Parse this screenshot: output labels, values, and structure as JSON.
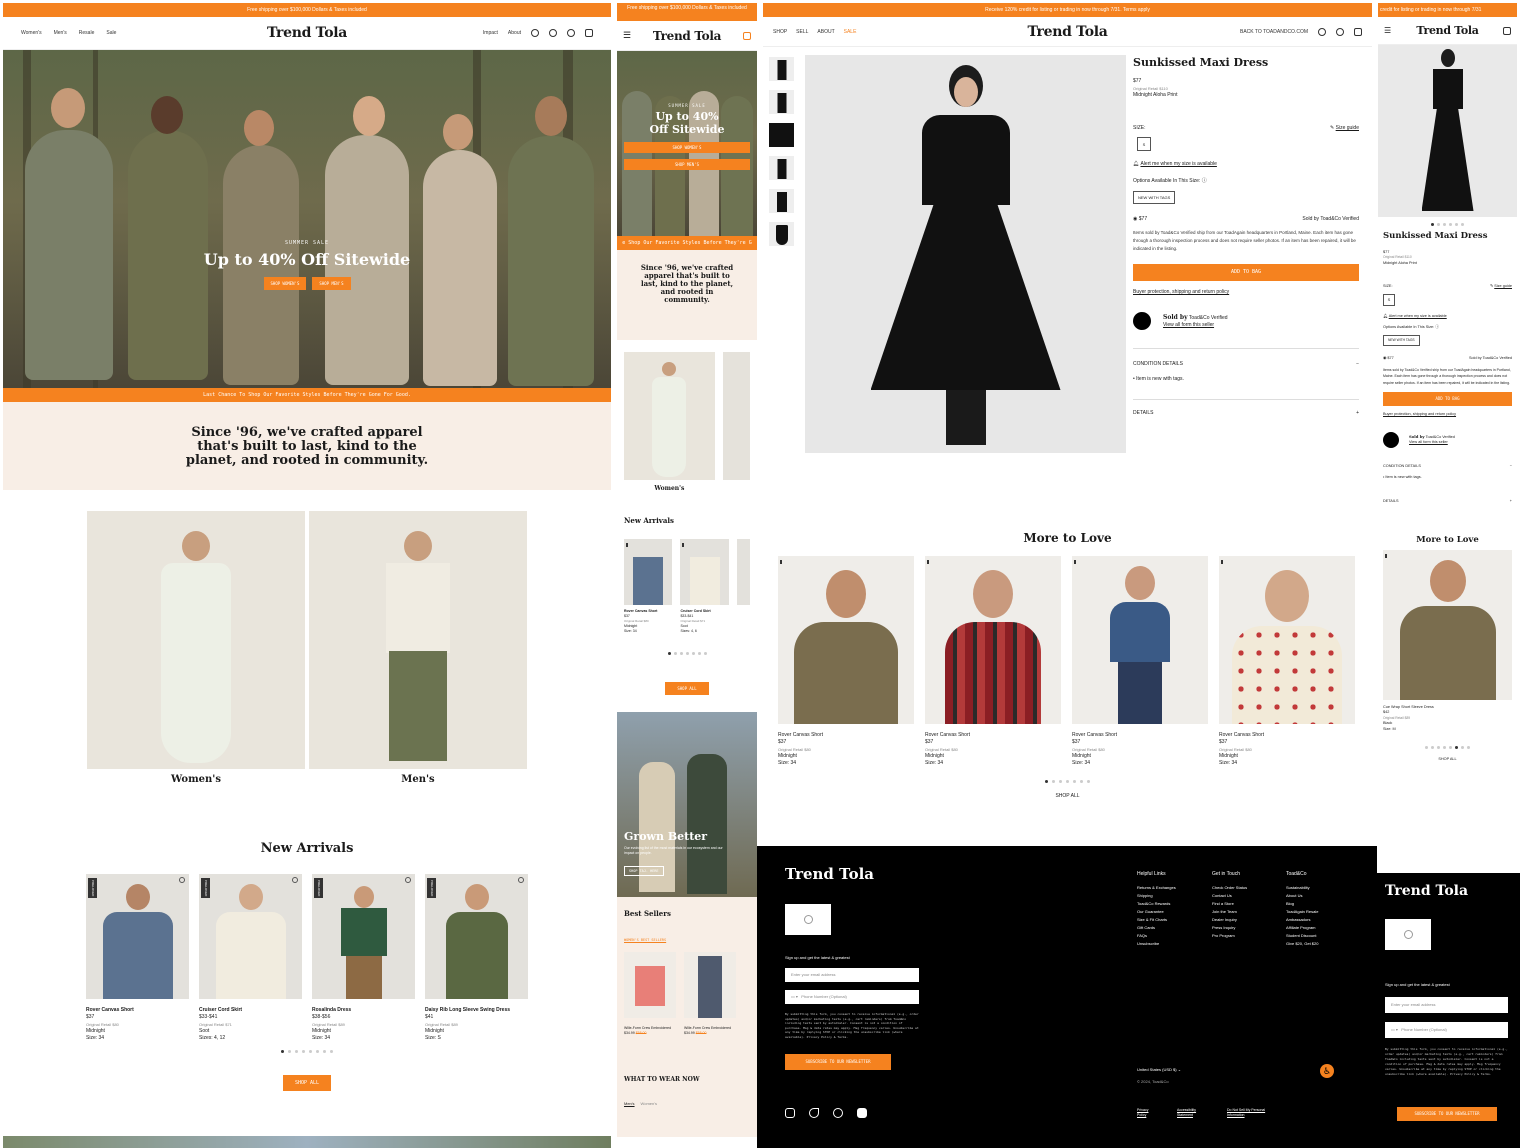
{
  "brand": "Trend Tola",
  "colors": {
    "accent": "#f5821f",
    "cream": "#f8eee6",
    "footer": "#000000"
  },
  "desktop_home": {
    "promo": "Free shipping over $100,000 Dollars & Taxes included",
    "nav_left": [
      "Women's",
      "Men's",
      "Resale",
      "Sale"
    ],
    "nav_right": [
      "Impact",
      "About"
    ],
    "hero_kicker": "SUMMER SALE",
    "hero_title": "Up to 40% Off Sitewide",
    "hero_btn_women": "SHOP WOMEN'S",
    "hero_btn_men": "SHOP MEN'S",
    "ticker": "Last Chance To Shop Our Favorite Styles Before They're Gone For Good.",
    "mission": "Since '96, we've crafted apparel that's built to last, kind to the planet, and rooted in community.",
    "categories": [
      "Women's",
      "Men's"
    ],
    "new_arrivals_title": "New Arrivals",
    "tag": "PRELOVED",
    "products": [
      {
        "name": "Rover Canvas Short",
        "price": "$37",
        "retail": "Original Retail $80",
        "color": "Midnight",
        "size": "Size: 34"
      },
      {
        "name": "Cruiser Cord Skirt",
        "price": "$33-$41",
        "retail": "Original Retail $71",
        "color": "Soot",
        "size": "Sizes: 4, 12"
      },
      {
        "name": "Rosalinda Dress",
        "price": "$38-$56",
        "retail": "Original Retail $89",
        "color": "Midnight",
        "size": "Size: 34"
      },
      {
        "name": "Daisy Rib Long Sleeve Swing Dress",
        "price": "$41",
        "retail": "Original Retail $89",
        "color": "Midnight",
        "size": "Size: S"
      }
    ],
    "shop_all": "SHOP ALL"
  },
  "mobile_home": {
    "promo": "Free shipping over $100,000 Dollars & Taxes included",
    "hero_kicker": "SUMMER SALE",
    "hero_title": "Up to 40% Off Sitewide",
    "hero_btn_women": "SHOP WOMEN'S",
    "hero_btn_men": "SHOP MEN'S",
    "ticker": "e Shop Our Favorite Styles Before They're G",
    "mission": "Since '96, we've crafted apparel that's built to last, kind to the planet, and rooted in community.",
    "cat_label": "Women's",
    "new_arrivals_title": "New Arrivals",
    "products": [
      {
        "name": "Rover Canvas Short",
        "price": "$37",
        "retail": "Original Retail $80",
        "color": "Midnight",
        "size": "Size: 34"
      },
      {
        "name": "Cruiser Cord Skirt",
        "price": "$33-$41",
        "retail": "Original Retail $71",
        "color": "Soot",
        "size": "Sizes: 4, 6"
      }
    ],
    "shop_all": "SHOP ALL",
    "grown_title": "Grown Better",
    "grown_text": "Our evolving list of the most materials in our ecosystem and our impact on people.",
    "grown_btn": "SHOP TAJ. HERE",
    "best_sellers": "Best Sellers",
    "best_tab": "WOMEN'S BEST SELLERS",
    "best_products": [
      {
        "name": "Wille-Form Crew Embroidered",
        "sale": "$34.99",
        "orig": "$58.00"
      },
      {
        "name": "Wille-Form Crew Embroidered",
        "sale": "$34.99",
        "orig": "$58.00"
      }
    ],
    "wear_title": "WHAT TO WEAR NOW",
    "wear_tabs": [
      "Men's",
      "Women's"
    ]
  },
  "desktop_pdp": {
    "promo": "Receive 120% credit for listing or trading in now through 7/31. Terms apply",
    "nav_left": [
      "SHOP",
      "SELL",
      "ABOUT",
      "SALE"
    ],
    "back_link": "BACK TO TOADANDCO.COM",
    "title": "Sunkissed Maxi Dress",
    "price": "$77",
    "retail": "Original Retail $110",
    "color": "Midnight Aloha Print",
    "size_label": "SIZE:",
    "size_guide": "Size guide",
    "size_value": "S",
    "alert_link": "Alert me when my size is available",
    "options_label": "Options Available In This Size:",
    "option_pill": "NEW WITH TAGS",
    "radio_price": "$77",
    "sold_by": "Sold by Toad&Co Verified",
    "desc": "Items sold by Toad&Co Verified ship from our ToadAgain headquarters in Portland, Maine. Each item has gone through a thorough inspection process and does not require seller photos. If an item has been repaired, it will be indicated in the listing.",
    "add_to_bag": "ADD TO BAG",
    "policy_link": "Buyer protection, shipping and return policy",
    "seller_title": "Sold by",
    "seller_name": "Toad&Co Verified",
    "seller_link": "View all form this seller",
    "condition_label": "CONDITION DETAILS",
    "condition_item": "Item is new with tags.",
    "details_label": "DETAILS",
    "more_title": "More to Love",
    "more_products": [
      {
        "name": "Rover Canvas Short",
        "price": "$37",
        "retail": "Original Retail $80",
        "color": "Midnight",
        "size": "Size: 34"
      },
      {
        "name": "Rover Canvas Short",
        "price": "$37",
        "retail": "Original Retail $80",
        "color": "Midnight",
        "size": "Size: 34"
      },
      {
        "name": "Rover Canvas Short",
        "price": "$37",
        "retail": "Original Retail $80",
        "color": "Midnight",
        "size": "Size: 34"
      },
      {
        "name": "Rover Canvas Short",
        "price": "$37",
        "retail": "Original Retail $80",
        "color": "Midnight",
        "size": "Size: 34"
      }
    ],
    "shop_all": "SHOP ALL"
  },
  "mobile_pdp": {
    "promo": "credit for listing or trading in now through 7/31",
    "title": "Sunkissed Maxi Dress",
    "price": "$77",
    "retail": "Original Retail $110",
    "color": "Midnight Aloha Print",
    "size_label": "SIZE:",
    "size_guide": "Size guide",
    "size_value": "S",
    "alert_link": "Alert me when my size is available",
    "options_label": "Options Available In This Size:",
    "option_pill": "NEW WITH TAGS",
    "radio_price": "$77",
    "sold_by": "Sold by Toad&Co Verified",
    "desc": "Items sold by Toad&Co Verified ship from our ToadAgain headquarters in Portland, Maine. Each item has gone through a thorough inspection process and does not require seller photos. If an item has been repaired, it will be indicated in the listing.",
    "add_to_bag": "ADD TO BAG",
    "policy_link": "Buyer protection, shipping and return policy",
    "seller_title": "Sold by",
    "seller_name": "Toad&Co Verified",
    "seller_link": "View all form this seller",
    "condition_label": "CONDITION DETAILS",
    "condition_item": "Item is new with tags.",
    "details_label": "DETAILS",
    "more_title": "More to Love",
    "more_product": {
      "name": "Cue Wrap Short Sleeve Dress",
      "price": "$42",
      "retail": "Original Retail $89",
      "color": "Black",
      "size": "Size: M"
    },
    "shop_all": "SHOP ALL"
  },
  "footer": {
    "signup": "Sign up and get the latest & greatest",
    "email_placeholder": "Enter your email address",
    "phone_placeholder": "Phone Number (Optional)",
    "legal": "By submitting this form, you consent to receive informational (e.g., order updates) and/or marketing texts (e.g., cart reminders) from Toad&Co including texts sent by autodialer. Consent is not a condition of purchase. Msg & data rates may apply. Msg frequency varies. Unsubscribe at any time by replying STOP or clicking the unsubscribe link (where available). Privacy Policy & Terms.",
    "subscribe": "SUBSCRIBE TO OUR NEWSLETTER",
    "col1_title": "Helpful Links",
    "col1": [
      "Returns & Exchanges",
      "Shipping",
      "Toad&Co Rewards",
      "Our Guarantee",
      "Size & Fit Charts",
      "Gift Cards",
      "FAQs",
      "Unsubscribe"
    ],
    "col2_title": "Get in Touch",
    "col2": [
      "Check Order Status",
      "Contact Us",
      "Find a Store",
      "Join the Team",
      "Dealer Inquiry",
      "Press Inquiry",
      "Pro Program"
    ],
    "col3_title": "Toad&Co",
    "col3": [
      "Sustainability",
      "About Us",
      "Blog",
      "ToadAgain Resale",
      "Ambassadors",
      "Affiliate Program",
      "Student Discount",
      "Give $20, Get $20"
    ],
    "region": "United States (USD $)",
    "copyright": "© 2024, Toad&Co",
    "bottom_links": [
      "Privacy Policy",
      "Accessibility Statement",
      "Do Not Sell My Personal Information"
    ]
  }
}
